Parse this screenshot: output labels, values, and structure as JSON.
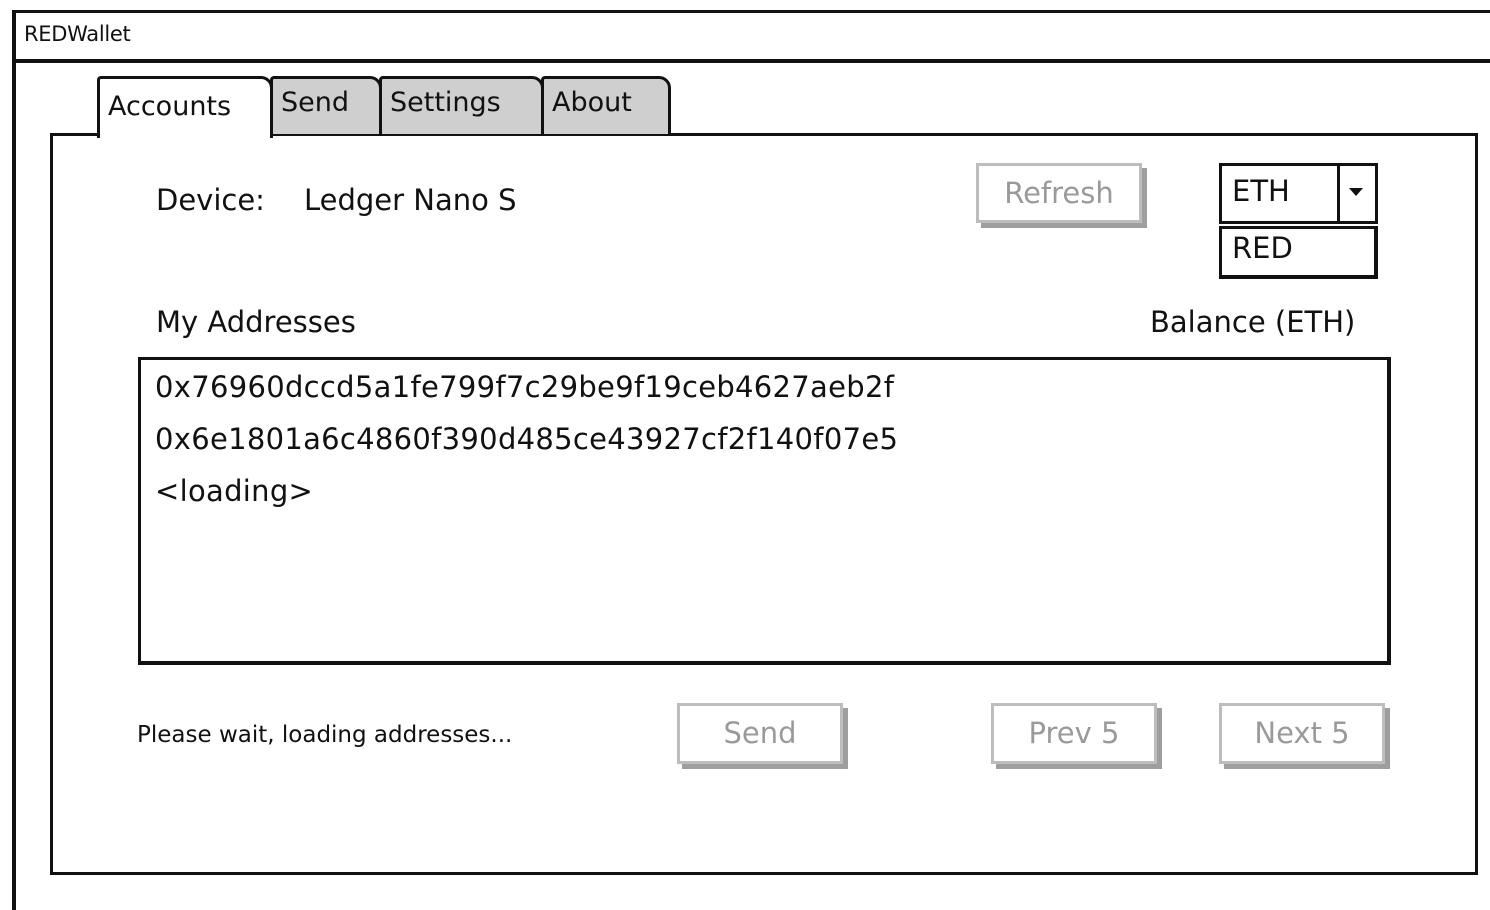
{
  "window": {
    "title": "REDWallet"
  },
  "tabs": [
    {
      "label": "Accounts",
      "active": true
    },
    {
      "label": "Send",
      "active": false
    },
    {
      "label": "Settings",
      "active": false
    },
    {
      "label": "About",
      "active": false
    }
  ],
  "device": {
    "label": "Device:",
    "value": "Ledger Nano S"
  },
  "toolbar": {
    "refresh_label": "Refresh"
  },
  "currency": {
    "selected": "ETH",
    "options": [
      "RED"
    ]
  },
  "addresses": {
    "heading": "My Addresses",
    "balance_heading": "Balance (ETH)",
    "items": [
      "0x76960dccd5a1fe799f7c29be9f19ceb4627aeb2f",
      "0x6e1801a6c4860f390d485ce43927cf2f140f07e5",
      "<loading>"
    ]
  },
  "footer": {
    "status": "Please wait, loading addresses...",
    "send_label": "Send",
    "prev_label": "Prev 5",
    "next_label": "Next 5"
  },
  "colors": {
    "border": "#111111",
    "inactive_tab": "#cfcfcf",
    "disabled_text": "#9a9a9a",
    "button_shadow": "#9e9e9e"
  }
}
